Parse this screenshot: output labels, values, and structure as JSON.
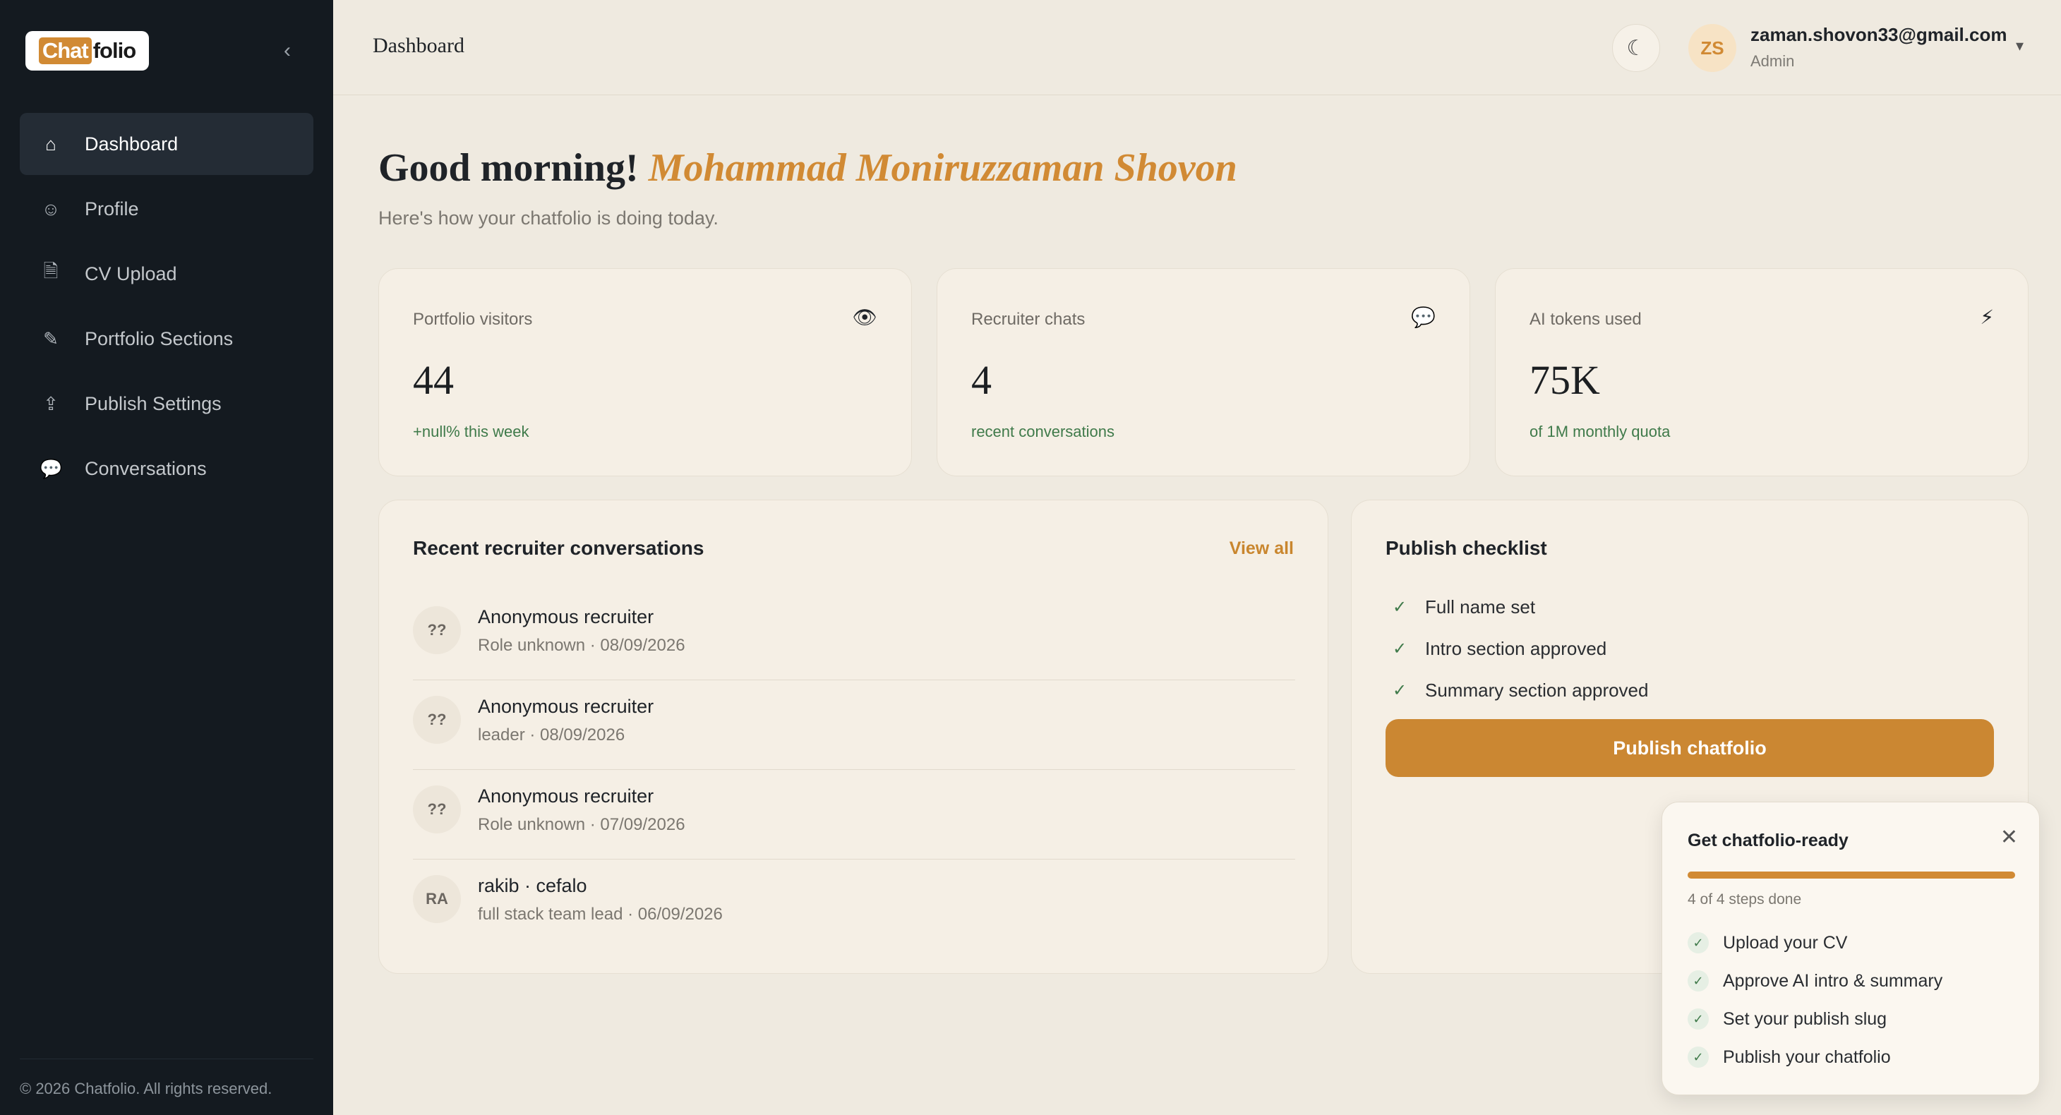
{
  "sidebar": {
    "logo": {
      "part1": "Chat",
      "part2": "folio"
    },
    "collapse_icon": "‹",
    "items": [
      {
        "label": "Dashboard",
        "icon": "⌂",
        "active": true
      },
      {
        "label": "Profile",
        "icon": "☺"
      },
      {
        "label": "CV Upload",
        "icon": "🗎"
      },
      {
        "label": "Portfolio Sections",
        "icon": "✎"
      },
      {
        "label": "Publish Settings",
        "icon": "⇪"
      },
      {
        "label": "Conversations",
        "icon": "💬"
      }
    ],
    "copyright": "© 2026 Chatfolio. All rights reserved."
  },
  "header": {
    "title": "Dashboard",
    "theme_icon": "☾",
    "user": {
      "initials": "ZS",
      "email": "zaman.shovon33@gmail.com",
      "role": "Admin",
      "chevron": "▾"
    }
  },
  "greeting": {
    "prefix": "Good morning!",
    "name": "Mohammad Moniruzzaman Shovon",
    "subtitle": "Here's how your chatfolio is doing today."
  },
  "stats": [
    {
      "label": "Portfolio visitors",
      "icon": "👁",
      "value": "44",
      "sub": "+null% this week"
    },
    {
      "label": "Recruiter chats",
      "icon": "💬",
      "value": "4",
      "sub": "recent conversations"
    },
    {
      "label": "AI tokens used",
      "icon": "⚡",
      "value": "75K",
      "sub": "of 1M monthly quota"
    }
  ],
  "conversations": {
    "title": "Recent recruiter conversations",
    "view_all": "View all",
    "items": [
      {
        "initials": "??",
        "name": "Anonymous recruiter",
        "meta": "Role unknown · 08/09/2026"
      },
      {
        "initials": "??",
        "name": "Anonymous recruiter",
        "meta": "leader · 08/09/2026"
      },
      {
        "initials": "??",
        "name": "Anonymous recruiter",
        "meta": "Role unknown · 07/09/2026"
      },
      {
        "initials": "RA",
        "name": "rakib · cefalo",
        "meta": "full stack team lead · 06/09/2026"
      }
    ]
  },
  "checklist": {
    "title": "Publish checklist",
    "check_mark": "✓",
    "items": [
      "Full name set",
      "Intro section approved",
      "Summary section approved"
    ],
    "button": "Publish chatfolio"
  },
  "widget": {
    "title": "Get chatfolio-ready",
    "close_icon": "✕",
    "progress": 1.0,
    "progress_label": "4 of 4 steps done",
    "check_mark": "✓",
    "items": [
      "Upload your CV",
      "Approve AI intro & summary",
      "Set your publish slug",
      "Publish your chatfolio"
    ]
  },
  "colors": {
    "accent": "#d18a34",
    "sidebar": "#141a20",
    "success": "#3f7a4a"
  }
}
